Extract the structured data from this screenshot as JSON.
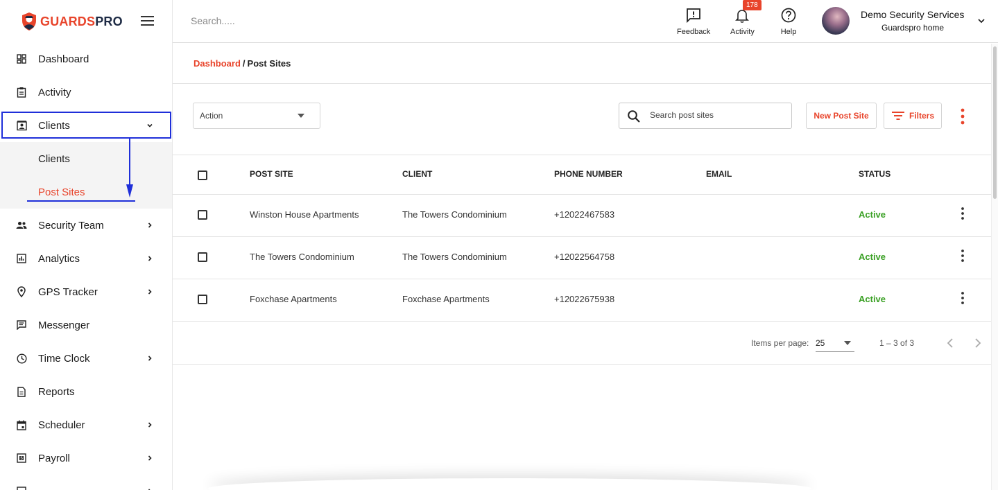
{
  "brand": {
    "name_part1": "GUARDS",
    "name_part2": "PRO",
    "color_accent": "#e8442b",
    "color_dark": "#1d2a44"
  },
  "sidebar": {
    "items": [
      {
        "label": "Dashboard",
        "icon": "dashboard-icon"
      },
      {
        "label": "Activity",
        "icon": "clipboard-icon"
      },
      {
        "label": "Clients",
        "icon": "contact-card-icon",
        "expanded": true
      },
      {
        "label": "Security Team",
        "icon": "people-icon"
      },
      {
        "label": "Analytics",
        "icon": "bar-chart-icon"
      },
      {
        "label": "GPS Tracker",
        "icon": "location-pin-icon"
      },
      {
        "label": "Messenger",
        "icon": "message-icon"
      },
      {
        "label": "Time Clock",
        "icon": "clock-icon"
      },
      {
        "label": "Reports",
        "icon": "document-icon"
      },
      {
        "label": "Scheduler",
        "icon": "calendar-icon"
      },
      {
        "label": "Payroll",
        "icon": "payroll-icon"
      }
    ],
    "sub_items": [
      {
        "label": "Clients"
      },
      {
        "label": "Post Sites",
        "active": true
      }
    ]
  },
  "topbar": {
    "search_placeholder": "Search.....",
    "feedback_label": "Feedback",
    "activity_label": "Activity",
    "activity_badge": "178",
    "help_label": "Help",
    "org_name": "Demo Security Services",
    "org_sub": "Guardspro home"
  },
  "breadcrumb": {
    "parent": "Dashboard",
    "separator": "/",
    "current": "Post Sites"
  },
  "toolbar": {
    "action_select": "Action",
    "search_placeholder": "Search post sites",
    "new_button": "New Post Site",
    "filters_button": "Filters"
  },
  "table": {
    "headers": {
      "post_site": "POST SITE",
      "client": "CLIENT",
      "phone": "PHONE NUMBER",
      "email": "EMAIL",
      "status": "STATUS"
    },
    "rows": [
      {
        "post_site": "Winston House Apartments",
        "client": "The Towers Condominium",
        "phone": "+12022467583",
        "email": "",
        "status": "Active"
      },
      {
        "post_site": "The Towers Condominium",
        "client": "The Towers Condominium",
        "phone": "+12022564758",
        "email": "",
        "status": "Active"
      },
      {
        "post_site": "Foxchase Apartments",
        "client": "Foxchase Apartments",
        "phone": "+12022675938",
        "email": "",
        "status": "Active"
      }
    ],
    "status_color": "#3aa024"
  },
  "pagination": {
    "items_per_page_label": "Items per page:",
    "items_per_page": "25",
    "range": "1 – 3 of 3"
  },
  "annotation_color": "#1f2fd9"
}
